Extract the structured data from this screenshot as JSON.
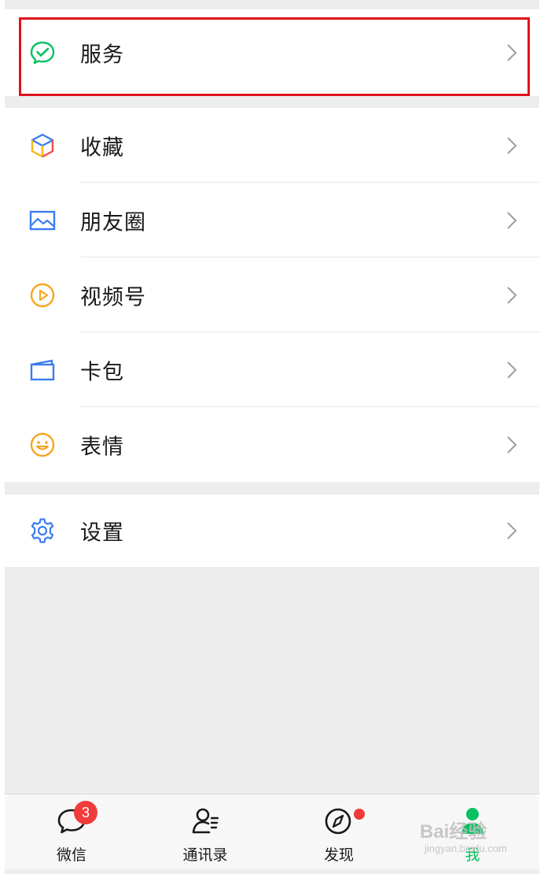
{
  "menu": {
    "service": {
      "label": "服务",
      "icon": "service-check-icon"
    },
    "group2": [
      {
        "label": "收藏",
        "icon": "favorites-cube-icon"
      },
      {
        "label": "朋友圈",
        "icon": "moments-picture-icon"
      },
      {
        "label": "视频号",
        "icon": "channels-play-icon"
      },
      {
        "label": "卡包",
        "icon": "card-wallet-icon"
      },
      {
        "label": "表情",
        "icon": "sticker-smile-icon"
      }
    ],
    "settings": {
      "label": "设置",
      "icon": "settings-gear-icon"
    }
  },
  "tabbar": {
    "tabs": [
      {
        "label": "微信",
        "badge": "3",
        "icon": "chats-bubble-icon"
      },
      {
        "label": "通讯录",
        "icon": "contacts-icon"
      },
      {
        "label": "发现",
        "icon": "discover-compass-icon"
      },
      {
        "label": "我",
        "icon": "me-person-icon",
        "active": true
      }
    ]
  },
  "watermark": {
    "main": "Bai经验",
    "sub": "jingyan.baidu.com"
  },
  "colors": {
    "brand_green": "#07c160",
    "badge_red": "#f23c3c",
    "highlight_red": "#e0121b",
    "background": "#ededed"
  }
}
